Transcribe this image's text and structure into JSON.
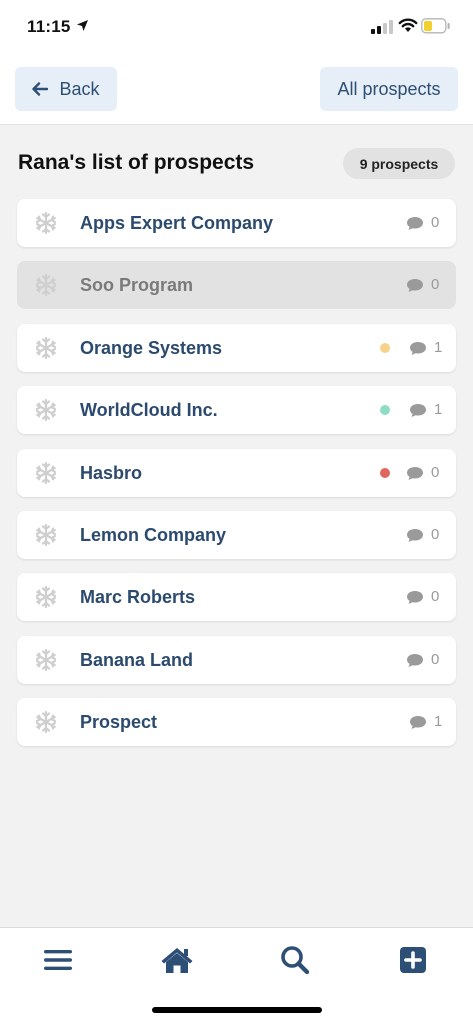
{
  "status_bar": {
    "time": "11:15",
    "location_icon": "location-arrow-icon",
    "signal_icon": "cellular-signal-icon",
    "wifi_icon": "wifi-icon",
    "battery_icon": "battery-low-icon"
  },
  "nav": {
    "back_label": "Back",
    "all_prospects_label": "All prospects"
  },
  "list": {
    "title": "Rana's list of prospects",
    "count_label": "9 prospects",
    "items": [
      {
        "name": "Apps Expert Company",
        "comments": "0",
        "status_color": null,
        "dimmed": false
      },
      {
        "name": "Soo Program",
        "comments": "0",
        "status_color": null,
        "dimmed": true
      },
      {
        "name": "Orange Systems",
        "comments": "1",
        "status_color": "#f6d28b",
        "dimmed": false
      },
      {
        "name": "WorldCloud Inc.",
        "comments": "1",
        "status_color": "#8fdcc4",
        "dimmed": false
      },
      {
        "name": "Hasbro",
        "comments": "0",
        "status_color": "#e0665d",
        "dimmed": false
      },
      {
        "name": "Lemon Company",
        "comments": "0",
        "status_color": null,
        "dimmed": false
      },
      {
        "name": "Marc Roberts",
        "comments": "0",
        "status_color": null,
        "dimmed": false
      },
      {
        "name": "Banana Land",
        "comments": "0",
        "status_color": null,
        "dimmed": false
      },
      {
        "name": "Prospect",
        "comments": "1",
        "status_color": null,
        "dimmed": false
      }
    ]
  },
  "tabbar": {
    "menu_icon": "menu-icon",
    "home_icon": "home-icon",
    "search_icon": "search-icon",
    "add_icon": "add-square-icon"
  },
  "colors": {
    "accent": "#2e4f75",
    "nav_button_bg": "#e6eef7",
    "row_text": "#2b4a6e"
  }
}
